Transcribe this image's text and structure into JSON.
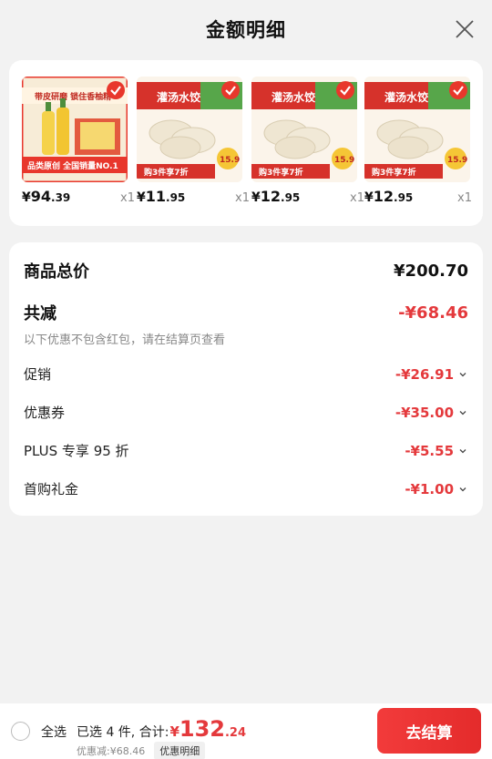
{
  "header": {
    "title": "金额明细"
  },
  "products": [
    {
      "currency": "¥",
      "price_int": "94",
      "price_dec": ".39",
      "qty": "x1",
      "banner": "带皮研磨 锁住香柚精",
      "label_top": "品类原创 全国销量NO.1",
      "colors": {
        "bg": "#e8372c"
      }
    },
    {
      "currency": "¥",
      "price_int": "11",
      "price_dec": ".95",
      "qty": "x1",
      "banner": "灌汤水饺",
      "label_top": "购3件享7折",
      "badge": "15.9"
    },
    {
      "currency": "¥",
      "price_int": "12",
      "price_dec": ".95",
      "qty": "x1",
      "banner": "灌汤水饺",
      "label_top": "购3件享7折",
      "badge": "15.9"
    },
    {
      "currency": "¥",
      "price_int": "12",
      "price_dec": ".95",
      "qty": "x1",
      "banner": "灌汤水饺",
      "label_top": "购3件享7折",
      "badge": "15.9"
    }
  ],
  "detail": {
    "total_label": "商品总价",
    "total_value": "¥200.70",
    "reduce_label": "共减",
    "reduce_value": "-¥68.46",
    "note": "以下优惠不包含红包，请在结算页查看",
    "items": [
      {
        "label": "促销",
        "value": "-¥26.91"
      },
      {
        "label": "优惠券",
        "value": "-¥35.00"
      },
      {
        "label": "PLUS 专享 95 折",
        "value": "-¥5.55"
      },
      {
        "label": "首购礼金",
        "value": "-¥1.00"
      }
    ]
  },
  "footer": {
    "select_all": "全选",
    "summary": "已选 4 件, 合计:",
    "currency": "¥",
    "total_int": "132",
    "total_dec": ".24",
    "discount": "优惠减:¥68.46",
    "discount_detail": "优惠明细",
    "checkout": "去结算"
  },
  "colors": {
    "accent": "#e4393c",
    "check": "#e8372c"
  }
}
